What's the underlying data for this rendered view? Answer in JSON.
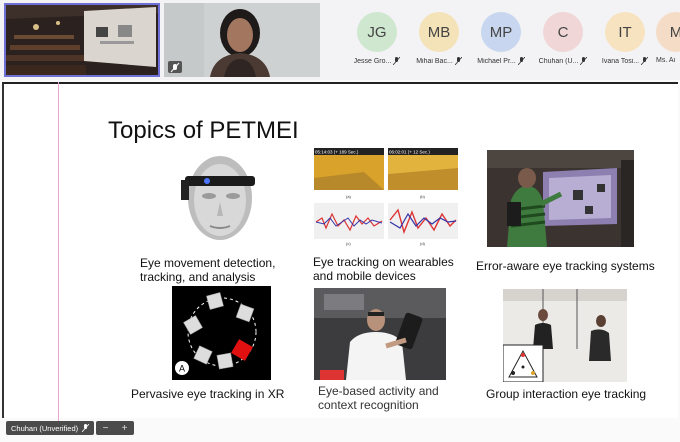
{
  "participants": [
    {
      "initials": "JG",
      "name": "Jesse Gro...",
      "color": "#cfe7cf"
    },
    {
      "initials": "MB",
      "name": "Mihai Bac...",
      "color": "#f4e2b8"
    },
    {
      "initials": "MP",
      "name": "Michael Pr...",
      "color": "#c9d6ef"
    },
    {
      "initials": "C",
      "name": "Chuhan (U...",
      "color": "#f0d6d6"
    },
    {
      "initials": "IT",
      "name": "Ivana Tosi...",
      "color": "#f7e3bf"
    },
    {
      "initials": "M",
      "name": "Ms. Ai",
      "color": "#f5dcc7"
    }
  ],
  "slide": {
    "title": "Topics of PETMEI",
    "captions": {
      "c1": "Eye movement detection,\ntracking, and analysis",
      "c2": "Eye tracking on wearables\nand mobile devices",
      "c3": "Error-aware eye tracking systems",
      "c4": "Pervasive eye tracking in XR",
      "c5": "Eye-based activity and\ncontext recognition",
      "c6": "Group interaction eye tracking"
    },
    "wearable_figure": {
      "ts_a": "05:14:03 (+ 189 Sec.)",
      "ts_b": "06:02:01 (+ 12 Sec.)",
      "label_a": "(a)",
      "label_b": "(b)",
      "label_c": "(c)",
      "label_d": "(d)"
    },
    "xr_marker": "A"
  },
  "self_view": {
    "name": "Chuhan (Unverified)"
  },
  "zoom": {
    "minus": "−",
    "plus": "+"
  }
}
